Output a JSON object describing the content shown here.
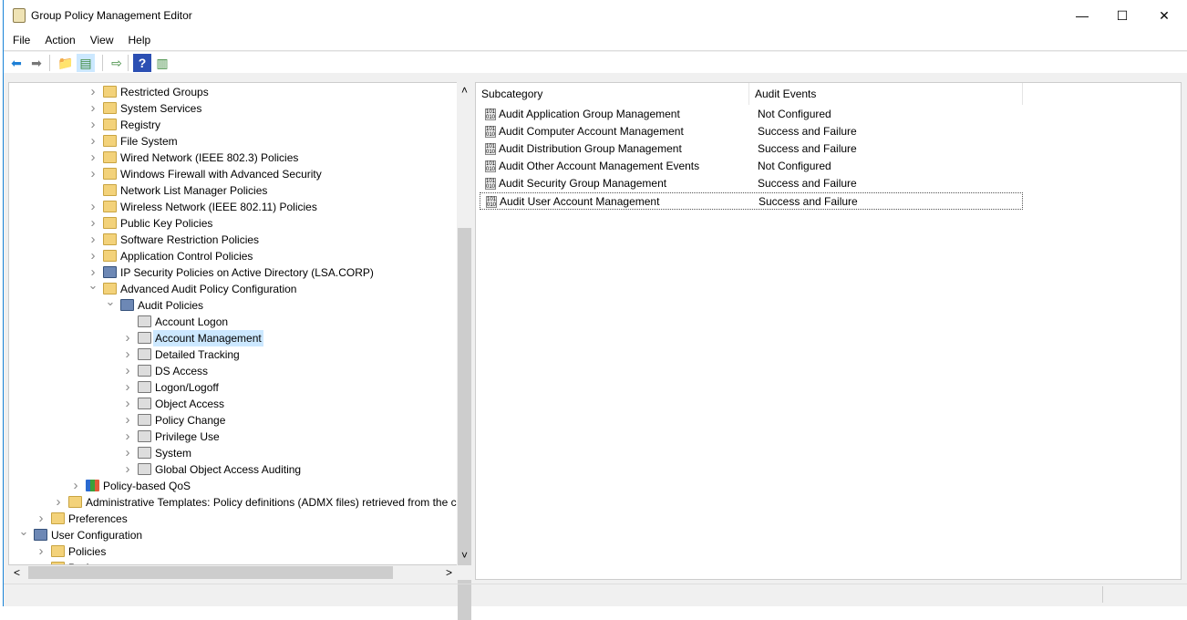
{
  "window": {
    "title": "Group Policy Management Editor",
    "minimize": "—",
    "maximize": "☐",
    "close": "✕"
  },
  "menu": [
    "File",
    "Action",
    "View",
    "Help"
  ],
  "toolbar": [
    {
      "icon": "back-arrow-icon",
      "glyph": "⬅",
      "color": "#1c7fd6"
    },
    {
      "icon": "forward-arrow-icon",
      "glyph": "➡",
      "color": "#777777"
    },
    {
      "icon": "up-folder-icon",
      "glyph": "📁",
      "color": "#d9a830"
    },
    {
      "icon": "show-hide-tree-icon",
      "glyph": "▤",
      "color": "#3d8a3d"
    },
    {
      "icon": "export-list-icon",
      "glyph": "⇨",
      "color": "#3d8a3d"
    },
    {
      "icon": "help-icon",
      "glyph": "?",
      "color": "#2b4fb3"
    },
    {
      "icon": "action-pane-icon",
      "glyph": "▥",
      "color": "#3d8a3d"
    }
  ],
  "tree": [
    {
      "label": "Restricted Groups",
      "level": 4,
      "expander": "collapsed",
      "icon": "locked-folder-icon"
    },
    {
      "label": "System Services",
      "level": 4,
      "expander": "collapsed",
      "icon": "locked-folder-icon"
    },
    {
      "label": "Registry",
      "level": 4,
      "expander": "collapsed",
      "icon": "locked-folder-icon"
    },
    {
      "label": "File System",
      "level": 4,
      "expander": "collapsed",
      "icon": "locked-folder-icon"
    },
    {
      "label": "Wired Network (IEEE 802.3) Policies",
      "level": 4,
      "expander": "collapsed",
      "icon": "network-icon"
    },
    {
      "label": "Windows Firewall with Advanced Security",
      "level": 4,
      "expander": "collapsed",
      "icon": "folder-icon"
    },
    {
      "label": "Network List Manager Policies",
      "level": 4,
      "expander": "none",
      "icon": "folder-icon"
    },
    {
      "label": "Wireless Network (IEEE 802.11) Policies",
      "level": 4,
      "expander": "collapsed",
      "icon": "wireless-icon"
    },
    {
      "label": "Public Key Policies",
      "level": 4,
      "expander": "collapsed",
      "icon": "folder-icon"
    },
    {
      "label": "Software Restriction Policies",
      "level": 4,
      "expander": "collapsed",
      "icon": "folder-icon"
    },
    {
      "label": "Application Control Policies",
      "level": 4,
      "expander": "collapsed",
      "icon": "folder-icon"
    },
    {
      "label": "IP Security Policies on Active Directory (LSA.CORP)",
      "level": 4,
      "expander": "collapsed",
      "icon": "ip-security-icon"
    },
    {
      "label": "Advanced Audit Policy Configuration",
      "level": 4,
      "expander": "expanded",
      "icon": "folder-icon"
    },
    {
      "label": "Audit Policies",
      "level": 5,
      "expander": "expanded",
      "icon": "audit-policies-icon"
    },
    {
      "label": "Account Logon",
      "level": 6,
      "expander": "none",
      "icon": "policy-icon"
    },
    {
      "label": "Account Management",
      "level": 6,
      "expander": "collapsed",
      "icon": "policy-icon",
      "selected": true
    },
    {
      "label": "Detailed Tracking",
      "level": 6,
      "expander": "collapsed",
      "icon": "policy-icon"
    },
    {
      "label": "DS Access",
      "level": 6,
      "expander": "collapsed",
      "icon": "policy-icon"
    },
    {
      "label": "Logon/Logoff",
      "level": 6,
      "expander": "collapsed",
      "icon": "policy-icon"
    },
    {
      "label": "Object Access",
      "level": 6,
      "expander": "collapsed",
      "icon": "policy-icon"
    },
    {
      "label": "Policy Change",
      "level": 6,
      "expander": "collapsed",
      "icon": "policy-icon"
    },
    {
      "label": "Privilege Use",
      "level": 6,
      "expander": "collapsed",
      "icon": "policy-icon"
    },
    {
      "label": "System",
      "level": 6,
      "expander": "collapsed",
      "icon": "policy-icon"
    },
    {
      "label": "Global Object Access Auditing",
      "level": 6,
      "expander": "collapsed",
      "icon": "policy-icon"
    },
    {
      "label": "Policy-based QoS",
      "level": 3,
      "expander": "collapsed",
      "icon": "bar-chart-icon"
    },
    {
      "label": "Administrative Templates: Policy definitions (ADMX files) retrieved from the c",
      "level": 2,
      "expander": "collapsed",
      "icon": "folder-icon"
    },
    {
      "label": "Preferences",
      "level": 1,
      "expander": "collapsed",
      "icon": "folder-icon"
    },
    {
      "label": "User Configuration",
      "level": 0,
      "expander": "expanded",
      "icon": "user-config-icon"
    },
    {
      "label": "Policies",
      "level": 1,
      "expander": "collapsed",
      "icon": "folder-icon"
    },
    {
      "label": "Prefe",
      "level": 1,
      "expander": "collapsed",
      "icon": "folder-icon"
    }
  ],
  "list": {
    "columns": [
      "Subcategory",
      "Audit Events"
    ],
    "rows": [
      [
        "Audit Application Group Management",
        "Not Configured"
      ],
      [
        "Audit Computer Account Management",
        "Success and Failure"
      ],
      [
        "Audit Distribution Group Management",
        "Success and Failure"
      ],
      [
        "Audit Other Account Management Events",
        "Not Configured"
      ],
      [
        "Audit Security Group Management",
        "Success and Failure"
      ],
      [
        "Audit User Account Management",
        "Success and Failure"
      ]
    ]
  },
  "scroll": {
    "up": "˄",
    "down": "˅",
    "left": "<",
    "right": ">"
  }
}
